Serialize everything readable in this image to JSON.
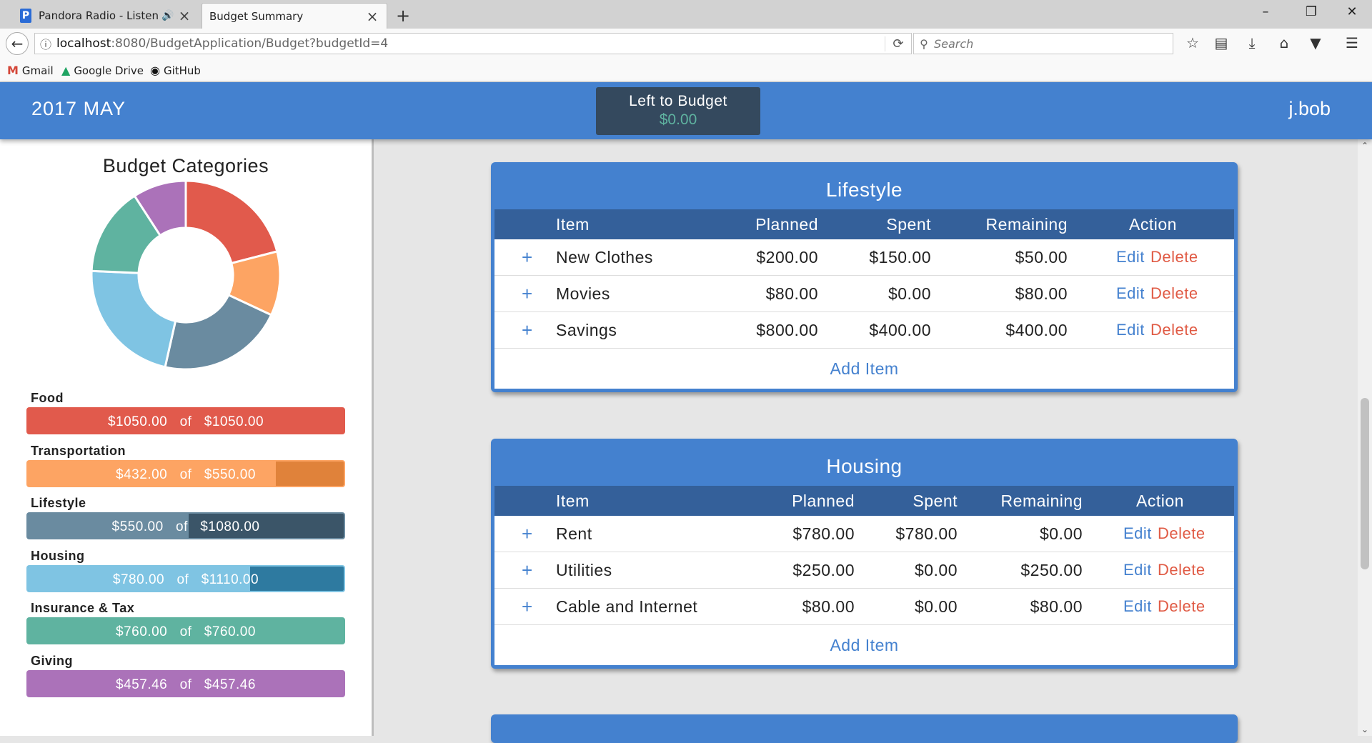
{
  "browser": {
    "tabs": [
      {
        "title": "Pandora Radio - Listen t",
        "active": false
      },
      {
        "title": "Budget Summary",
        "active": true
      }
    ],
    "url_host": "localhost",
    "url_path": ":8080/BudgetApplication/Budget?budgetId=4",
    "search_placeholder": "Search",
    "bookmarks": [
      "Gmail",
      "Google Drive",
      "GitHub"
    ]
  },
  "header": {
    "period": "2017 MAY",
    "left_to_budget_label": "Left to Budget",
    "left_to_budget_value": "$0.00",
    "user": "j.bob"
  },
  "sidebar": {
    "title": "Budget Categories",
    "of_label": "of",
    "categories": [
      {
        "name": "Food",
        "spent": "$1050.00",
        "planned": "$1050.00",
        "spent_fraction": 1.0,
        "color": "#e15a4c",
        "bar_bg": "#d6473a"
      },
      {
        "name": "Transportation",
        "spent": "$432.00",
        "planned": "$550.00",
        "spent_fraction": 0.785,
        "color": "#fda463",
        "bar_bg": "#e0823a"
      },
      {
        "name": "Lifestyle",
        "spent": "$550.00",
        "planned": "$1080.00",
        "spent_fraction": 0.509,
        "color": "#6a8ba0",
        "bar_bg": "#3b5568"
      },
      {
        "name": "Housing",
        "spent": "$780.00",
        "planned": "$1110.00",
        "spent_fraction": 0.703,
        "color": "#7fc4e3",
        "bar_bg": "#2e7aa0"
      },
      {
        "name": "Insurance & Tax",
        "spent": "$760.00",
        "planned": "$760.00",
        "spent_fraction": 1.0,
        "color": "#5fb3a0",
        "bar_bg": "#4a9a86"
      },
      {
        "name": "Giving",
        "spent": "$457.46",
        "planned": "$457.46",
        "spent_fraction": 1.0,
        "color": "#ab72b9",
        "bar_bg": "#9558a3"
      }
    ],
    "donut": [
      {
        "name": "Food",
        "value": 1050,
        "color": "#e15a4c"
      },
      {
        "name": "Transportation",
        "value": 550,
        "color": "#fda463"
      },
      {
        "name": "Lifestyle",
        "value": 1080,
        "color": "#6a8ba0"
      },
      {
        "name": "Housing",
        "value": 1110,
        "color": "#7fc4e3"
      },
      {
        "name": "Insurance & Tax",
        "value": 760,
        "color": "#5fb3a0"
      },
      {
        "name": "Giving",
        "value": 457.46,
        "color": "#ab72b9"
      }
    ]
  },
  "columns": {
    "item": "Item",
    "planned": "Planned",
    "spent": "Spent",
    "remaining": "Remaining",
    "action": "Action"
  },
  "actions": {
    "plus": "+",
    "edit": "Edit",
    "delete": "Delete",
    "add_item": "Add Item"
  },
  "cards": [
    {
      "title": "Lifestyle",
      "rows": [
        {
          "item": "New Clothes",
          "planned": "$200.00",
          "spent": "$150.00",
          "remaining": "$50.00"
        },
        {
          "item": "Movies",
          "planned": "$80.00",
          "spent": "$0.00",
          "remaining": "$80.00"
        },
        {
          "item": "Savings",
          "planned": "$800.00",
          "spent": "$400.00",
          "remaining": "$400.00"
        }
      ]
    },
    {
      "title": "Housing",
      "rows": [
        {
          "item": "Rent",
          "planned": "$780.00",
          "spent": "$780.00",
          "remaining": "$0.00"
        },
        {
          "item": "Utilities",
          "planned": "$250.00",
          "spent": "$0.00",
          "remaining": "$250.00"
        },
        {
          "item": "Cable and Internet",
          "planned": "$80.00",
          "spent": "$0.00",
          "remaining": "$80.00"
        }
      ]
    }
  ]
}
